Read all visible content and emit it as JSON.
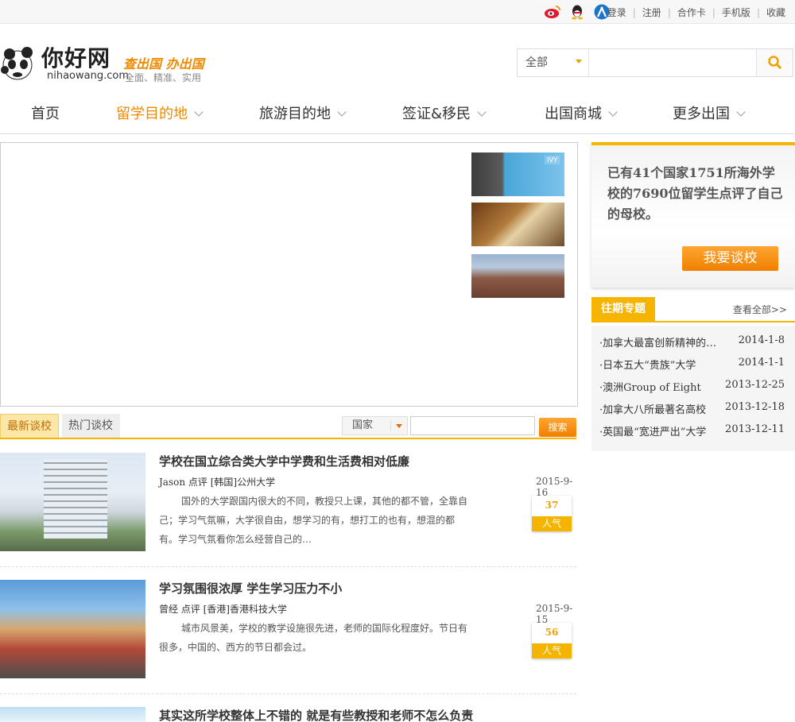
{
  "topbar": {
    "social": [
      "weibo-icon",
      "qq-icon",
      "renren-icon"
    ],
    "links": [
      "登录",
      "注册",
      "合作卡",
      "手机版",
      "收藏"
    ]
  },
  "header": {
    "logo_name": "你好网",
    "logo_slogan": "查出国 办出国",
    "logo_domain": "nihaowang.com",
    "logo_tagline": "全面、精准、实用",
    "search": {
      "scope": "全部",
      "placeholder": ""
    }
  },
  "nav": {
    "items": [
      {
        "label": "首页",
        "active": false
      },
      {
        "label": "留学目的地",
        "active": true
      },
      {
        "label": "旅游目的地",
        "active": false
      },
      {
        "label": "签证&移民",
        "active": false
      },
      {
        "label": "出国商城",
        "active": false
      },
      {
        "label": "更多出国",
        "active": false
      }
    ]
  },
  "promo": {
    "text": "已有41个国家1751所海外学校的7690位留学生点评了自己的母校。",
    "button": "我要谈校"
  },
  "topics": {
    "heading": "往期专题",
    "more": "查看全部>>",
    "items": [
      {
        "title": "·加拿大最富创新精神的大学",
        "date": "2014-1-8"
      },
      {
        "title": "·日本五大“贵族”大学",
        "date": "2014-1-1"
      },
      {
        "title": "·澳洲Group of Eight",
        "date": "2013-12-25"
      },
      {
        "title": "·加拿大八所最著名高校",
        "date": "2013-12-18"
      },
      {
        "title": "·英国最“宽进严出”大学",
        "date": "2013-12-11"
      }
    ]
  },
  "tabs": {
    "latest": "最新谈校",
    "hot": "热门谈校",
    "country_select": "国家",
    "search_button": "搜索"
  },
  "reviews": [
    {
      "title": "学校在国立综合类大学中学费和生活费相对低廉",
      "meta": "Jason 点评  [韩国]公州大学",
      "date": "2015-9-16",
      "body": "国外的大学跟国内很大的不同，教授只上课，其他的都不管，全靠自己；学习气氛嘛，大学很自由，想学习的有，想打工的也有，想混的都有。学习气氛看你怎么经营自己的…",
      "popularity": "37",
      "pop_label": "人气"
    },
    {
      "title": "学习氛围很浓厚  学生学习压力不小",
      "meta": "曾经  点评  [香港]香港科技大学",
      "date": "2015-9-15",
      "body": "城市风景美，学校的教学设施很先进，老师的国际化程度好。节日有很多，中国的、西方的节日都会过。",
      "popularity": "56",
      "pop_label": "人气"
    },
    {
      "title": "其实这所学校整体上不错的 就是有些教授和老师不怎么负责"
    }
  ],
  "colors": {
    "accent": "#f5b400",
    "active_nav": "#f08a00"
  }
}
